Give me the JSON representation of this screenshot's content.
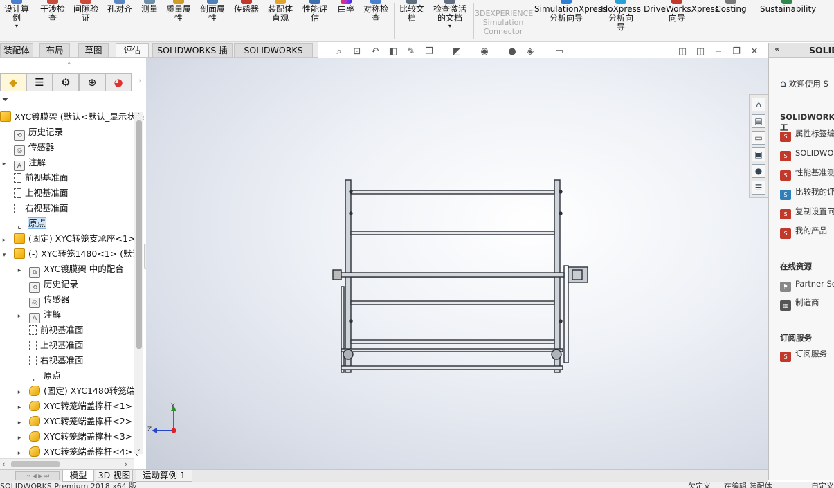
{
  "ribbon": {
    "buttons": [
      {
        "label": "设计算\n例",
        "caret": true
      },
      {
        "label": "干涉检\n查"
      },
      {
        "label": "间隙验\n证"
      },
      {
        "label": "孔对齐"
      },
      {
        "label": "测量"
      },
      {
        "label": "质量属\n性"
      },
      {
        "label": "剖面属\n性"
      },
      {
        "label": "传感器"
      },
      {
        "label": "装配体\n直观"
      },
      {
        "label": "性能评\n估"
      },
      {
        "label": "曲率"
      },
      {
        "label": "对称检\n查"
      },
      {
        "label": "比较文\n档"
      },
      {
        "label": "检查激活\n的文档",
        "caret": true
      },
      {
        "label": "3DEXPERIENCE\nSimulation\nConnector",
        "disabled": true
      },
      {
        "label": "SimulationXpress\n分析向导"
      },
      {
        "label": "FloXpress\n分析向\n导"
      },
      {
        "label": "DriveWorksXpress\n向导"
      },
      {
        "label": "Costing"
      },
      {
        "label": "Sustainability"
      }
    ]
  },
  "command_tabs": [
    "装配体",
    "布局",
    "草图",
    "评估",
    "SOLIDWORKS 插件",
    "SOLIDWORKS MBD"
  ],
  "active_tab": "评估",
  "tree": {
    "root_label": "XYC镀膜架 (默认<默认_显示状态",
    "items": [
      {
        "label": "历史记录",
        "icon": "history-icon",
        "indent": 1
      },
      {
        "label": "传感器",
        "icon": "sensor-icon",
        "indent": 1
      },
      {
        "label": "注解",
        "icon": "annotation-icon",
        "indent": 1,
        "expander": "▸"
      },
      {
        "label": "前视基准面",
        "icon": "plane-icon",
        "indent": 1
      },
      {
        "label": "上视基准面",
        "icon": "plane-icon",
        "indent": 1
      },
      {
        "label": "右视基准面",
        "icon": "plane-icon",
        "indent": 1
      },
      {
        "label": "原点",
        "icon": "origin-icon",
        "indent": 1,
        "selected": true
      },
      {
        "label": "(固定) XYC转笼支承座<1>",
        "icon": "assembly-icon",
        "indent": 1,
        "expander": "▸"
      },
      {
        "label": "(-) XYC转笼1480<1> (默认",
        "icon": "assembly-icon",
        "indent": 1,
        "expander": "▾"
      },
      {
        "label": "XYC镀膜架 中的配合",
        "icon": "mates-icon",
        "indent": 2,
        "expander": "▸"
      },
      {
        "label": "历史记录",
        "icon": "history-icon",
        "indent": 2
      },
      {
        "label": "传感器",
        "icon": "sensor-icon",
        "indent": 2
      },
      {
        "label": "注解",
        "icon": "annotation-icon",
        "indent": 2,
        "expander": "▸"
      },
      {
        "label": "前视基准面",
        "icon": "plane-icon",
        "indent": 2
      },
      {
        "label": "上视基准面",
        "icon": "plane-icon",
        "indent": 2
      },
      {
        "label": "右视基准面",
        "icon": "plane-icon",
        "indent": 2
      },
      {
        "label": "原点",
        "icon": "origin-icon",
        "indent": 2
      },
      {
        "label": "(固定) XYC1480转笼端",
        "icon": "part-icon",
        "indent": 2,
        "expander": "▸"
      },
      {
        "label": "XYC转笼端盖撑杆<1> (",
        "icon": "part-icon",
        "indent": 2,
        "expander": "▸"
      },
      {
        "label": "XYC转笼端盖撑杆<2> (",
        "icon": "part-icon",
        "indent": 2,
        "expander": "▸"
      },
      {
        "label": "XYC转笼端盖撑杆<3> (",
        "icon": "part-icon",
        "indent": 2,
        "expander": "▸"
      },
      {
        "label": "XYC转笼端盖撑杆<4> (",
        "icon": "part-icon",
        "indent": 2,
        "expander": "▸"
      }
    ]
  },
  "task_pane": {
    "title": "SOLID",
    "welcome": "欢迎使用 S",
    "section_tools": "SOLIDWORKS 工",
    "tools": [
      "属性标签编",
      "SOLIDWOR",
      "性能基准测",
      "比较我的评",
      "复制设置向",
      "我的产品"
    ],
    "section_online": "在线资源",
    "online": [
      "Partner So",
      "制造商"
    ],
    "section_sub": "订阅服务",
    "sub": [
      "订阅服务"
    ]
  },
  "bottom_tabs": [
    "模型",
    "3D 视图",
    "运动算例 1"
  ],
  "active_bottom_tab": "模型",
  "status": {
    "left": "SOLIDWORKS Premium 2018 x64 版",
    "mid1": "欠定义",
    "mid2": "在编辑 装配体",
    "right": "自定义"
  },
  "triad": {
    "y": "Y",
    "z": "Z"
  }
}
